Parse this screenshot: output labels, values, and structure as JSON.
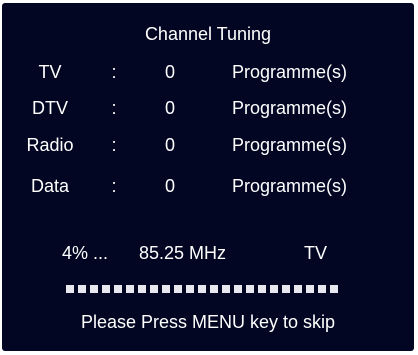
{
  "screen": {
    "title": "Channel Tuning",
    "rows": [
      {
        "label": "TV",
        "colon": ":",
        "count": "0",
        "unit": "Programme(s)"
      },
      {
        "label": "DTV",
        "colon": ":",
        "count": "0",
        "unit": "Programme(s)"
      },
      {
        "label": "Radio",
        "colon": ":",
        "count": "0",
        "unit": "Programme(s)"
      },
      {
        "label": "Data",
        "colon": ":",
        "count": "0",
        "unit": "Programme(s)"
      }
    ],
    "status": {
      "percent": "4% ...",
      "frequency": "85.25 MHz",
      "mode": "TV"
    },
    "progress": {
      "segments": 23,
      "fraction": 0.04
    },
    "hint": "Please Press MENU key to skip",
    "colors": {
      "background": "#020622",
      "text": "#ffffff",
      "progress_segment": "#e8e8ee"
    }
  }
}
